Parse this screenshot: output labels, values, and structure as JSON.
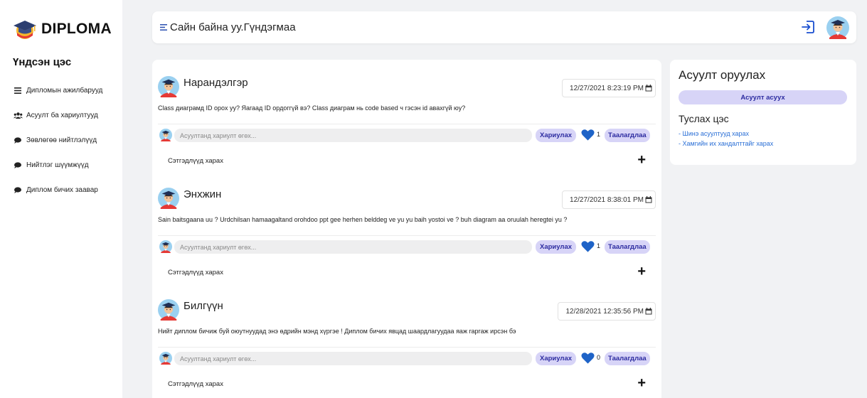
{
  "app": {
    "logo_text": "DIPLOMA"
  },
  "sidebar": {
    "title": "Үндсэн цэс",
    "items": [
      {
        "label": "Дипломын ажилбарууд",
        "icon": "list-icon"
      },
      {
        "label": "Асуулт ба хариултууд",
        "icon": "users-icon"
      },
      {
        "label": "Зөвлөгөө нийтлэлүүд",
        "icon": "chat-icon"
      },
      {
        "label": "Нийтлэг шүүмжүүд",
        "icon": "chat-icon"
      },
      {
        "label": "Диплом бичих заавар",
        "icon": "chat-icon"
      }
    ]
  },
  "header": {
    "greeting": "Сайн байна уу.Гүндэгмаа"
  },
  "posts": [
    {
      "author": "Нарандэлгэр",
      "date": "12/27/2021 8:23:19 PM",
      "body": "Class диаграмд ID орох уу? Яагаад ID ордоггүй вэ? Class диаграм нь code based ч гэсэн id авахгүй юу?",
      "answer_placeholder": "Асуултанд хариулт өгөх...",
      "reply_label": "Хариулах",
      "likes": "1",
      "like_label": "Таалагдлаа",
      "comments_label": "Сэтгэдлүүд харах",
      "plus": "+"
    },
    {
      "author": "Энхжин",
      "date": "12/27/2021 8:38:01 PM",
      "body": "Sain baitsgaana uu ? Urdchilsan hamaagaltand orohdoo ppt gee herhen belddeg ve yu yu baih yostoi ve ? buh diagram aa oruulah heregtei yu ?",
      "answer_placeholder": "Асуултанд хариулт өгөх...",
      "reply_label": "Хариулах",
      "likes": "1",
      "like_label": "Таалагдлаа",
      "comments_label": "Сэтгэдлүүд харах",
      "plus": "+"
    },
    {
      "author": "Билгүүн",
      "date": "12/28/2021 12:35:56 PM",
      "body": "Нийт диплом бичиж буй оюутнуудад энэ өдрийн мэнд хүргэе !  Диплом бичих явцад шаардлагуудаа яаж гаргаж ирсэн бэ",
      "answer_placeholder": "Асуултанд хариулт өгөх...",
      "reply_label": "Хариулах",
      "likes": "0",
      "like_label": "Таалагдлаа",
      "comments_label": "Сэтгэдлүүд харах",
      "plus": "+"
    }
  ],
  "right_panel": {
    "title": "Асуулт оруулах",
    "button": "Асуулт асуух",
    "subtitle": "Туслах цэс",
    "links": [
      "- Шинэ асуултууд харах",
      "- Хамгийн их хандалттайг харах"
    ]
  },
  "colors": {
    "accent_bg": "#d7d4f7",
    "accent_text": "#2c2ba0",
    "heart": "#1e63c7",
    "link": "#2a6fd6"
  }
}
